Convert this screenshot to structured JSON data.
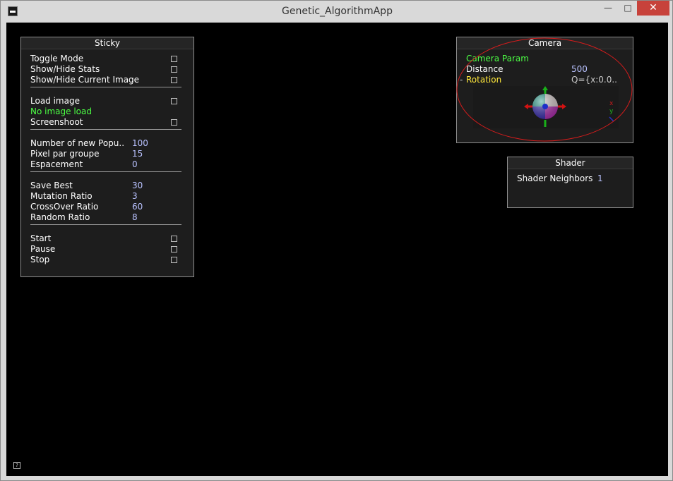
{
  "window": {
    "title": "Genetic_AlgorithmApp",
    "minimize": "—",
    "maximize": "□",
    "close": "✕"
  },
  "sticky": {
    "title": "Sticky",
    "groups": [
      [
        {
          "label": "Toggle Mode",
          "type": "check"
        },
        {
          "label": "Show/Hide Stats",
          "type": "check"
        },
        {
          "label": "Show/Hide Current Image",
          "type": "check"
        }
      ],
      [
        {
          "label": "Load image",
          "type": "check"
        },
        {
          "label": "No image load",
          "type": "status"
        },
        {
          "label": "Screenshoot",
          "type": "check"
        }
      ],
      [
        {
          "label": "Number of new Popu..",
          "value": "100"
        },
        {
          "label": "Pixel par groupe",
          "value": "15"
        },
        {
          "label": "Espacement",
          "value": "0"
        }
      ],
      [
        {
          "label": "Save Best",
          "value": "30"
        },
        {
          "label": "Mutation Ratio",
          "value": "3"
        },
        {
          "label": "CrossOver Ratio",
          "value": "60"
        },
        {
          "label": "Random Ratio",
          "value": "8"
        }
      ],
      [
        {
          "label": "Start",
          "type": "check"
        },
        {
          "label": "Pause",
          "type": "check"
        },
        {
          "label": "Stop",
          "type": "check"
        }
      ]
    ]
  },
  "camera": {
    "title": "Camera",
    "param_label": "Camera Param",
    "distance_label": "Distance",
    "distance_value": "500",
    "rotation_label": "Rotation",
    "rotation_value": "Q={x:0.0..",
    "axis_x": "x",
    "axis_y": "y",
    "highlight_color": "#d81c1c"
  },
  "shader": {
    "title": "Shader",
    "neighbors_label": "Shader Neighbors",
    "neighbors_value": "1"
  },
  "help_label": "?"
}
